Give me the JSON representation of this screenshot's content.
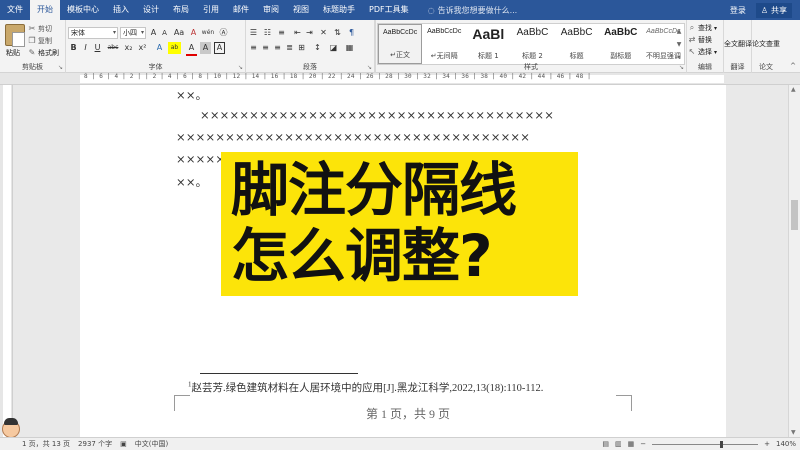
{
  "tabs": {
    "file": "文件",
    "home": "开始",
    "template": "模板中心",
    "insert": "插入",
    "design": "设计",
    "layout": "布局",
    "references": "引用",
    "mailings": "邮件",
    "review": "审阅",
    "view": "视图",
    "assistant": "标题助手",
    "pdf": "PDF工具集",
    "tell_me": "告诉我您想要做什么...",
    "login": "登录",
    "share": "共享"
  },
  "clipboard": {
    "paste": "粘贴",
    "cut": "剪切",
    "copy": "复制",
    "format_painter": "格式刷",
    "group": "剪贴板"
  },
  "font": {
    "name": "宋体",
    "size": "小四",
    "grow": "A",
    "shrink": "A",
    "case": "Aa",
    "clear": "A",
    "wen": "wén",
    "bold": "B",
    "italic": "I",
    "underline": "U",
    "strike": "abc",
    "subscript": "x₂",
    "superscript": "x²",
    "effects": "A",
    "highlight": "ab",
    "color": "A",
    "shade": "A",
    "border": "A",
    "group": "字体"
  },
  "paragraph": {
    "group": "段落"
  },
  "styles": {
    "group": "样式",
    "items": [
      {
        "sample": "AaBbCcDc",
        "name": "↵正文"
      },
      {
        "sample": "AaBbCcDc",
        "name": "↵无间隔"
      },
      {
        "sample": "AaBl",
        "name": "标题 1"
      },
      {
        "sample": "AaBbC",
        "name": "标题 2"
      },
      {
        "sample": "AaBbC",
        "name": "标题"
      },
      {
        "sample": "AaBbC",
        "name": "副标题"
      },
      {
        "sample": "AaBbCcDc",
        "name": "不明显强调"
      }
    ]
  },
  "editing": {
    "find": "查找",
    "replace": "替换",
    "select": "选择",
    "group": "编辑"
  },
  "translate": {
    "label": "全文翻译",
    "group": "翻译"
  },
  "paper": {
    "label": "论文查重",
    "group": "论文"
  },
  "ruler_text": "8 | 6 | 4 | 2 |   | 2 | 4 | 6 | 8 | 10 | 12 | 14 | 16 | 18 | 20 | 22 | 24 | 26 | 28 | 30 | 32 | 34 | 36 | 38 | 40 | 42 | 44 | 46 | 48 |",
  "document": {
    "line1": "××。",
    "line2": "××××××××××××××××××××××××××××××××××××",
    "line3": "××××××××××××××××××××××××××××××××××××",
    "line4": "××××××××××××××××××××××××××××××××××××",
    "line5": "××。",
    "footnote_num": "1",
    "footnote": "赵芸芳.绿色建筑材料在人居环境中的应用[J].黑龙江科学,2022,13(18):110-112.",
    "page_info": "第 1 页，共 9 页"
  },
  "overlay": {
    "line1": "脚注分隔线",
    "line2": "怎么调整?"
  },
  "status": {
    "page": "1 页，共 13 页",
    "words": "2937 个字",
    "lang": "中文(中国)",
    "zoom": "140%"
  },
  "colors": {
    "accent": "#2b579a",
    "overlay": "#fce409"
  }
}
